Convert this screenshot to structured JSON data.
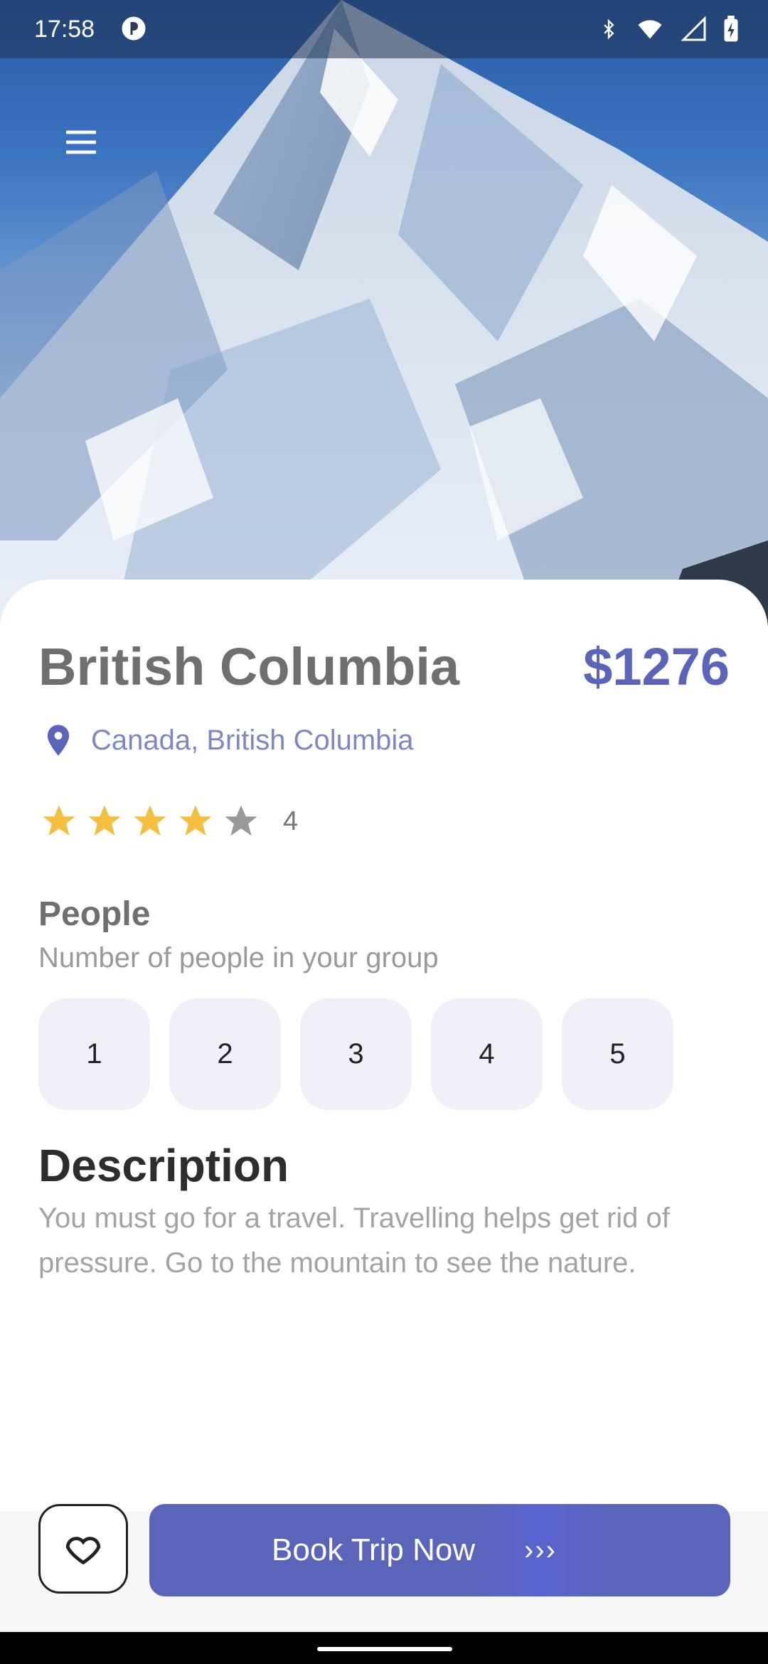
{
  "status_bar": {
    "time": "17:58",
    "icons": [
      "app-notification-icon",
      "bluetooth-icon",
      "wifi-icon",
      "signal-icon",
      "battery-icon"
    ]
  },
  "hero": {
    "image": "snowy-mountain-peak",
    "menu_icon": "hamburger-menu-icon"
  },
  "destination": {
    "title": "British Columbia",
    "price": "$1276",
    "location": "Canada, British Columbia",
    "rating": "4",
    "rating_value": 4,
    "rating_max": 5
  },
  "people": {
    "title": "People",
    "subtitle": "Number of people in your group",
    "options": [
      "1",
      "2",
      "3",
      "4",
      "5"
    ]
  },
  "description": {
    "title": "Description",
    "text": "You must go for a travel. Travelling helps get rid of pressure. Go to the mountain to see the nature."
  },
  "actions": {
    "favorite_icon": "heart-outline-icon",
    "book_label": "Book Trip Now",
    "book_arrows": "›››"
  },
  "colors": {
    "accent": "#5a64b8",
    "location_text": "#7f86c6",
    "star_filled": "#f2bf3f",
    "star_empty": "#999999",
    "option_bg": "#eff0f8"
  }
}
